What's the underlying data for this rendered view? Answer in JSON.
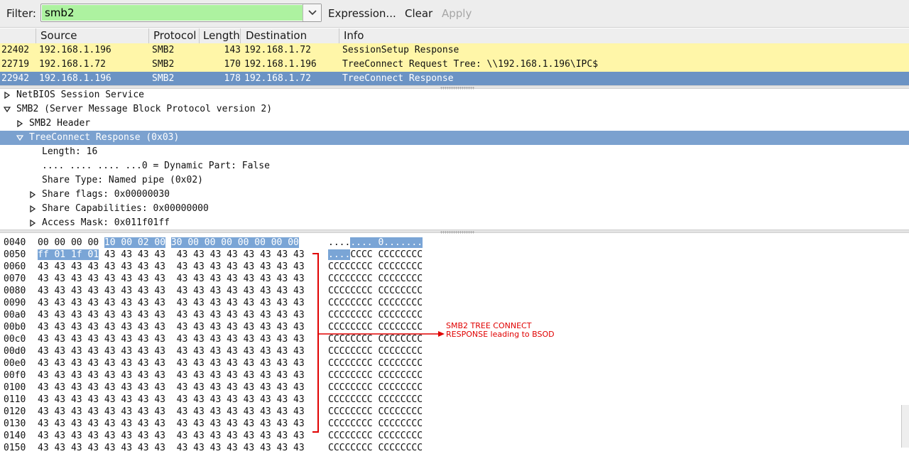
{
  "filter": {
    "label": "Filter:",
    "value": "smb2",
    "buttons": {
      "expression": "Expression...",
      "clear": "Clear",
      "apply": "Apply"
    }
  },
  "packet_list": {
    "columns": [
      "",
      "Source",
      "Protocol",
      "Length",
      "Destination",
      "Info"
    ],
    "rows": [
      {
        "no": "22402",
        "source": "192.168.1.196",
        "protocol": "SMB2",
        "length": "143",
        "destination": "192.168.1.72",
        "info": "SessionSetup Response",
        "selected": false
      },
      {
        "no": "22719",
        "source": "192.168.1.72",
        "protocol": "SMB2",
        "length": "170",
        "destination": "192.168.1.196",
        "info": "TreeConnect Request Tree: \\\\192.168.1.196\\IPC$",
        "selected": false
      },
      {
        "no": "22942",
        "source": "192.168.1.196",
        "protocol": "SMB2",
        "length": "178",
        "destination": "192.168.1.72",
        "info": "TreeConnect Response",
        "selected": true
      }
    ]
  },
  "detail_tree": [
    {
      "text": "NetBIOS Session Service",
      "level": 0,
      "arrow": "right",
      "selected": false
    },
    {
      "text": "SMB2 (Server Message Block Protocol version 2)",
      "level": 0,
      "arrow": "down",
      "selected": false
    },
    {
      "text": "SMB2 Header",
      "level": 1,
      "arrow": "right",
      "selected": false
    },
    {
      "text": "TreeConnect Response (0x03)",
      "level": 1,
      "arrow": "down",
      "selected": true
    },
    {
      "text": "Length: 16",
      "level": 2,
      "arrow": "none",
      "selected": false
    },
    {
      "text": ".... .... .... ...0 = Dynamic Part: False",
      "level": 2,
      "arrow": "none",
      "selected": false
    },
    {
      "text": "Share Type: Named pipe (0x02)",
      "level": 2,
      "arrow": "none",
      "selected": false
    },
    {
      "text": "Share flags: 0x00000030",
      "level": 2,
      "arrow": "right",
      "selected": false
    },
    {
      "text": "Share Capabilities: 0x00000000",
      "level": 2,
      "arrow": "right",
      "selected": false
    },
    {
      "text": "Access Mask: 0x011f01ff",
      "level": 2,
      "arrow": "right",
      "selected": false
    }
  ],
  "hex_dump": [
    {
      "offset": "0040",
      "b1": "00 00 00 00",
      "h1": "10 00 02 00",
      "b2": "",
      "h2": "30 00 00 00 00 00 00 00",
      "b3": "",
      "a_plain": "....",
      "a_hl": ".... 0.......",
      "a_rest": ""
    },
    {
      "offset": "0050",
      "b1": "",
      "h1": "ff 01 1f 01",
      "b2": " 43 43 43 43",
      "h2": "",
      "b3": "  43 43 43 43 43 43 43 43",
      "a_plain": "",
      "a_hl": "....",
      "a_rest": "CCCC CCCCCCCC"
    },
    {
      "offset": "0060",
      "b1": "43 43 43 43 43 43 43 43  43 43 43 43 43 43 43 43",
      "a_rest": "CCCCCCCC CCCCCCCC"
    },
    {
      "offset": "0070",
      "b1": "43 43 43 43 43 43 43 43  43 43 43 43 43 43 43 43",
      "a_rest": "CCCCCCCC CCCCCCCC"
    },
    {
      "offset": "0080",
      "b1": "43 43 43 43 43 43 43 43  43 43 43 43 43 43 43 43",
      "a_rest": "CCCCCCCC CCCCCCCC"
    },
    {
      "offset": "0090",
      "b1": "43 43 43 43 43 43 43 43  43 43 43 43 43 43 43 43",
      "a_rest": "CCCCCCCC CCCCCCCC"
    },
    {
      "offset": "00a0",
      "b1": "43 43 43 43 43 43 43 43  43 43 43 43 43 43 43 43",
      "a_rest": "CCCCCCCC CCCCCCCC"
    },
    {
      "offset": "00b0",
      "b1": "43 43 43 43 43 43 43 43  43 43 43 43 43 43 43 43",
      "a_rest": "CCCCCCCC CCCCCCCC"
    },
    {
      "offset": "00c0",
      "b1": "43 43 43 43 43 43 43 43  43 43 43 43 43 43 43 43",
      "a_rest": "CCCCCCCC CCCCCCCC"
    },
    {
      "offset": "00d0",
      "b1": "43 43 43 43 43 43 43 43  43 43 43 43 43 43 43 43",
      "a_rest": "CCCCCCCC CCCCCCCC"
    },
    {
      "offset": "00e0",
      "b1": "43 43 43 43 43 43 43 43  43 43 43 43 43 43 43 43",
      "a_rest": "CCCCCCCC CCCCCCCC"
    },
    {
      "offset": "00f0",
      "b1": "43 43 43 43 43 43 43 43  43 43 43 43 43 43 43 43",
      "a_rest": "CCCCCCCC CCCCCCCC"
    },
    {
      "offset": "0100",
      "b1": "43 43 43 43 43 43 43 43  43 43 43 43 43 43 43 43",
      "a_rest": "CCCCCCCC CCCCCCCC"
    },
    {
      "offset": "0110",
      "b1": "43 43 43 43 43 43 43 43  43 43 43 43 43 43 43 43",
      "a_rest": "CCCCCCCC CCCCCCCC"
    },
    {
      "offset": "0120",
      "b1": "43 43 43 43 43 43 43 43  43 43 43 43 43 43 43 43",
      "a_rest": "CCCCCCCC CCCCCCCC"
    },
    {
      "offset": "0130",
      "b1": "43 43 43 43 43 43 43 43  43 43 43 43 43 43 43 43",
      "a_rest": "CCCCCCCC CCCCCCCC"
    },
    {
      "offset": "0140",
      "b1": "43 43 43 43 43 43 43 43  43 43 43 43 43 43 43 43",
      "a_rest": "CCCCCCCC CCCCCCCC"
    },
    {
      "offset": "0150",
      "b1": "43 43 43 43 43 43 43 43  43 43 43 43 43 43 43 43",
      "a_rest": "CCCCCCCC CCCCCCCC"
    }
  ],
  "annotation": {
    "line1": "SMB2 TREE CONNECT",
    "line2": "RESPONSE leading to BSOD",
    "color": "#e00000"
  },
  "colors": {
    "filter_valid": "#adf2a0",
    "row_highlight": "#fff6a8",
    "row_selected": "#6b93c4",
    "hex_highlight": "#7aa5d6"
  }
}
